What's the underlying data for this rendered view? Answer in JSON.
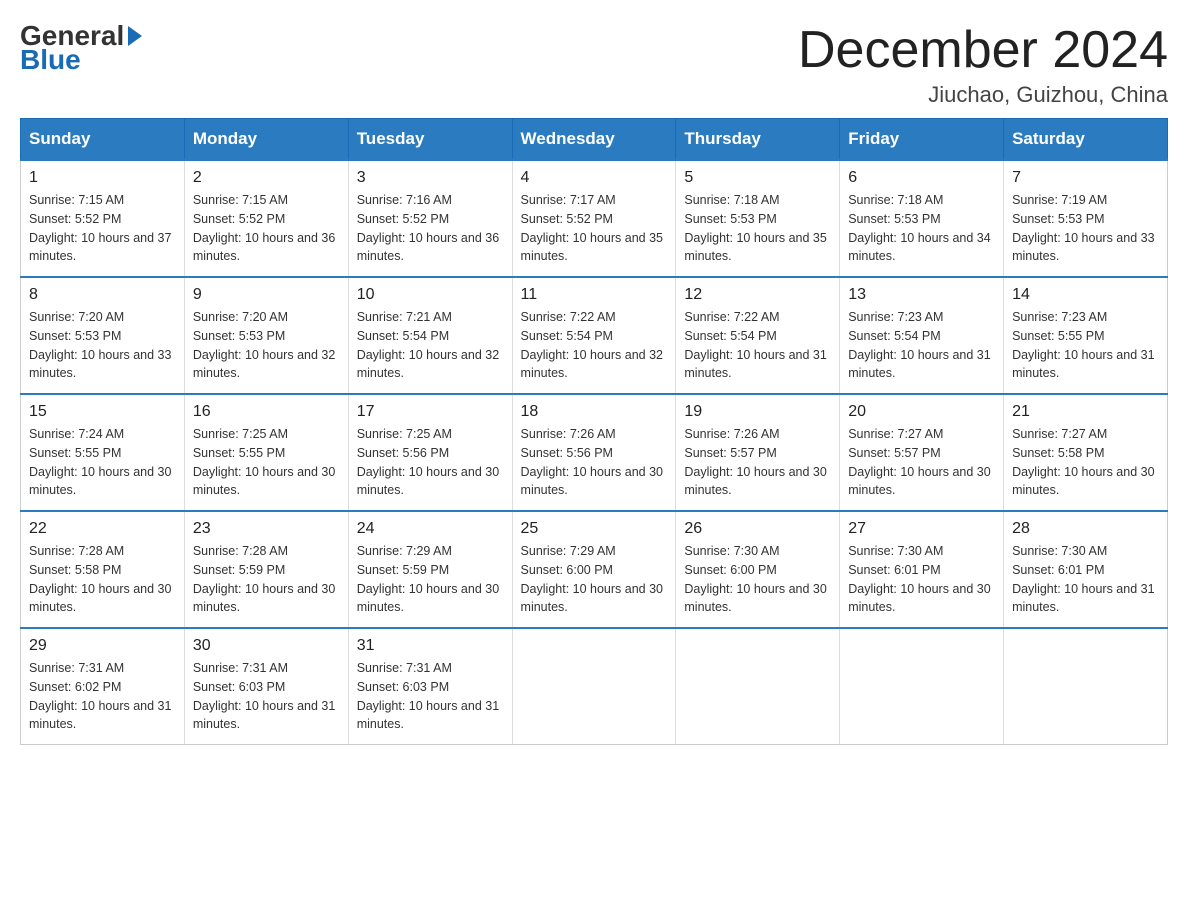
{
  "header": {
    "logo_general": "General",
    "logo_blue": "Blue",
    "month_year": "December 2024",
    "location": "Jiuchao, Guizhou, China"
  },
  "days_of_week": [
    "Sunday",
    "Monday",
    "Tuesday",
    "Wednesday",
    "Thursday",
    "Friday",
    "Saturday"
  ],
  "weeks": [
    [
      {
        "day": "1",
        "sunrise": "7:15 AM",
        "sunset": "5:52 PM",
        "daylight": "10 hours and 37 minutes."
      },
      {
        "day": "2",
        "sunrise": "7:15 AM",
        "sunset": "5:52 PM",
        "daylight": "10 hours and 36 minutes."
      },
      {
        "day": "3",
        "sunrise": "7:16 AM",
        "sunset": "5:52 PM",
        "daylight": "10 hours and 36 minutes."
      },
      {
        "day": "4",
        "sunrise": "7:17 AM",
        "sunset": "5:52 PM",
        "daylight": "10 hours and 35 minutes."
      },
      {
        "day": "5",
        "sunrise": "7:18 AM",
        "sunset": "5:53 PM",
        "daylight": "10 hours and 35 minutes."
      },
      {
        "day": "6",
        "sunrise": "7:18 AM",
        "sunset": "5:53 PM",
        "daylight": "10 hours and 34 minutes."
      },
      {
        "day": "7",
        "sunrise": "7:19 AM",
        "sunset": "5:53 PM",
        "daylight": "10 hours and 33 minutes."
      }
    ],
    [
      {
        "day": "8",
        "sunrise": "7:20 AM",
        "sunset": "5:53 PM",
        "daylight": "10 hours and 33 minutes."
      },
      {
        "day": "9",
        "sunrise": "7:20 AM",
        "sunset": "5:53 PM",
        "daylight": "10 hours and 32 minutes."
      },
      {
        "day": "10",
        "sunrise": "7:21 AM",
        "sunset": "5:54 PM",
        "daylight": "10 hours and 32 minutes."
      },
      {
        "day": "11",
        "sunrise": "7:22 AM",
        "sunset": "5:54 PM",
        "daylight": "10 hours and 32 minutes."
      },
      {
        "day": "12",
        "sunrise": "7:22 AM",
        "sunset": "5:54 PM",
        "daylight": "10 hours and 31 minutes."
      },
      {
        "day": "13",
        "sunrise": "7:23 AM",
        "sunset": "5:54 PM",
        "daylight": "10 hours and 31 minutes."
      },
      {
        "day": "14",
        "sunrise": "7:23 AM",
        "sunset": "5:55 PM",
        "daylight": "10 hours and 31 minutes."
      }
    ],
    [
      {
        "day": "15",
        "sunrise": "7:24 AM",
        "sunset": "5:55 PM",
        "daylight": "10 hours and 30 minutes."
      },
      {
        "day": "16",
        "sunrise": "7:25 AM",
        "sunset": "5:55 PM",
        "daylight": "10 hours and 30 minutes."
      },
      {
        "day": "17",
        "sunrise": "7:25 AM",
        "sunset": "5:56 PM",
        "daylight": "10 hours and 30 minutes."
      },
      {
        "day": "18",
        "sunrise": "7:26 AM",
        "sunset": "5:56 PM",
        "daylight": "10 hours and 30 minutes."
      },
      {
        "day": "19",
        "sunrise": "7:26 AM",
        "sunset": "5:57 PM",
        "daylight": "10 hours and 30 minutes."
      },
      {
        "day": "20",
        "sunrise": "7:27 AM",
        "sunset": "5:57 PM",
        "daylight": "10 hours and 30 minutes."
      },
      {
        "day": "21",
        "sunrise": "7:27 AM",
        "sunset": "5:58 PM",
        "daylight": "10 hours and 30 minutes."
      }
    ],
    [
      {
        "day": "22",
        "sunrise": "7:28 AM",
        "sunset": "5:58 PM",
        "daylight": "10 hours and 30 minutes."
      },
      {
        "day": "23",
        "sunrise": "7:28 AM",
        "sunset": "5:59 PM",
        "daylight": "10 hours and 30 minutes."
      },
      {
        "day": "24",
        "sunrise": "7:29 AM",
        "sunset": "5:59 PM",
        "daylight": "10 hours and 30 minutes."
      },
      {
        "day": "25",
        "sunrise": "7:29 AM",
        "sunset": "6:00 PM",
        "daylight": "10 hours and 30 minutes."
      },
      {
        "day": "26",
        "sunrise": "7:30 AM",
        "sunset": "6:00 PM",
        "daylight": "10 hours and 30 minutes."
      },
      {
        "day": "27",
        "sunrise": "7:30 AM",
        "sunset": "6:01 PM",
        "daylight": "10 hours and 30 minutes."
      },
      {
        "day": "28",
        "sunrise": "7:30 AM",
        "sunset": "6:01 PM",
        "daylight": "10 hours and 31 minutes."
      }
    ],
    [
      {
        "day": "29",
        "sunrise": "7:31 AM",
        "sunset": "6:02 PM",
        "daylight": "10 hours and 31 minutes."
      },
      {
        "day": "30",
        "sunrise": "7:31 AM",
        "sunset": "6:03 PM",
        "daylight": "10 hours and 31 minutes."
      },
      {
        "day": "31",
        "sunrise": "7:31 AM",
        "sunset": "6:03 PM",
        "daylight": "10 hours and 31 minutes."
      },
      null,
      null,
      null,
      null
    ]
  ],
  "labels": {
    "sunrise_prefix": "Sunrise: ",
    "sunset_prefix": "Sunset: ",
    "daylight_prefix": "Daylight: "
  }
}
